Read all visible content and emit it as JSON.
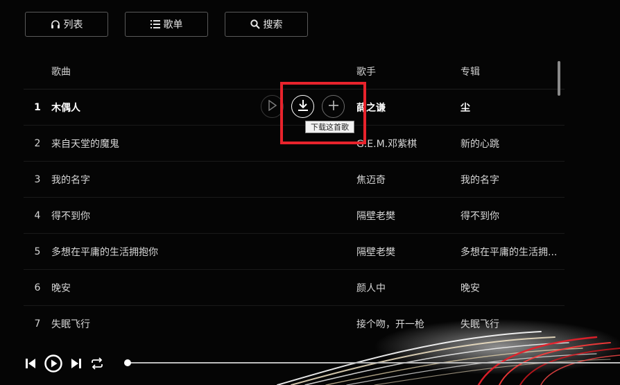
{
  "toolbar": {
    "list_label": "列表",
    "playlist_label": "歌单",
    "search_label": "搜索"
  },
  "table": {
    "headers": {
      "song": "歌曲",
      "singer": "歌手",
      "album": "专辑"
    },
    "rows": [
      {
        "num": "1",
        "song": "木偶人",
        "singer": "薛之谦",
        "album": "尘",
        "active": true
      },
      {
        "num": "2",
        "song": "来自天堂的魔鬼",
        "singer": "G.E.M.邓紫棋",
        "album": "新的心跳"
      },
      {
        "num": "3",
        "song": "我的名字",
        "singer": "焦迈奇",
        "album": "我的名字"
      },
      {
        "num": "4",
        "song": "得不到你",
        "singer": "隔壁老樊",
        "album": "得不到你"
      },
      {
        "num": "5",
        "song": "多想在平庸的生活拥抱你",
        "singer": "隔壁老樊",
        "album": "多想在平庸的生活拥..."
      },
      {
        "num": "6",
        "song": "晚安",
        "singer": "颜人中",
        "album": "晚安"
      },
      {
        "num": "7",
        "song": "失眠飞行",
        "singer": "接个吻，开一枪",
        "album": "失眠飞行"
      }
    ]
  },
  "row_actions": {
    "tooltip": "下载这首歌",
    "icons": [
      "play-icon",
      "download-icon",
      "plus-icon"
    ]
  },
  "player": {
    "progress": 0.0,
    "icons": [
      "prev-icon",
      "play-icon",
      "next-icon",
      "repeat-icon"
    ]
  },
  "colors": {
    "highlight_box": "#e8232c",
    "background": "#050505",
    "text": "#d6d6d6"
  }
}
